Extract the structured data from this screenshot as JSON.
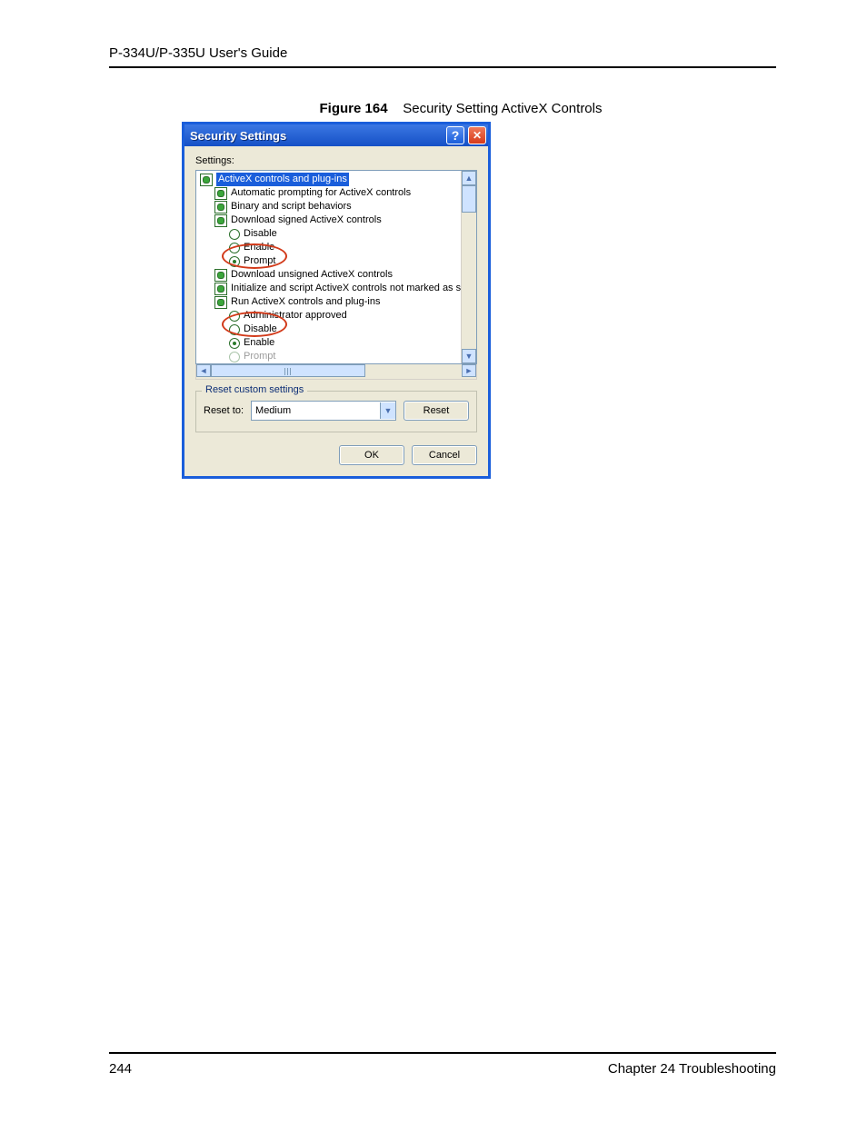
{
  "doc": {
    "running_head": "P-334U/P-335U User's Guide",
    "figure_label": "Figure 164",
    "figure_title": "Security Setting ActiveX Controls",
    "page_number": "244",
    "chapter": "Chapter 24 Troubleshooting"
  },
  "dialog": {
    "title": "Security Settings",
    "settings_label": "Settings:",
    "tree": {
      "root": "ActiveX controls and plug-ins",
      "n1": "Automatic prompting for ActiveX controls",
      "n2": "Binary and script behaviors",
      "n3": "Download signed ActiveX controls",
      "n3a": "Disable",
      "n3b": "Enable",
      "n3c": "Prompt",
      "n4": "Download unsigned ActiveX controls",
      "n5": "Initialize and script ActiveX controls not marked as safe",
      "n6": "Run ActiveX controls and plug-ins",
      "n6a": "Administrator approved",
      "n6b": "Disable",
      "n6c": "Enable",
      "n6d": "Prompt"
    },
    "reset_legend": "Reset custom settings",
    "reset_to_label": "Reset to:",
    "reset_level": "Medium",
    "reset_btn": "Reset",
    "ok_btn": "OK",
    "cancel_btn": "Cancel"
  }
}
